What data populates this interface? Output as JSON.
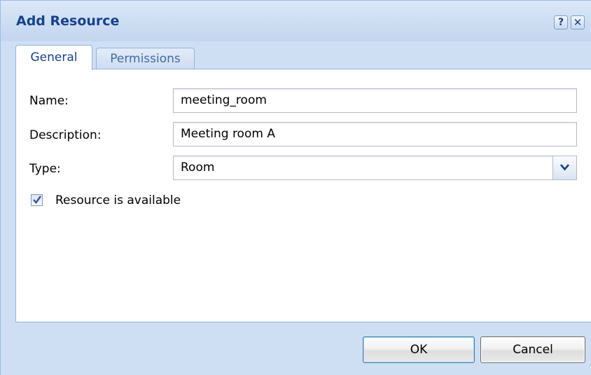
{
  "window": {
    "title": "Add Resource",
    "help_glyph": "?",
    "close_glyph": "✕"
  },
  "tabs": [
    {
      "label": "General",
      "active": true
    },
    {
      "label": "Permissions",
      "active": false
    }
  ],
  "form": {
    "name_label": "Name:",
    "name_value": "meeting_room",
    "description_label": "Description:",
    "description_value": "Meeting room A",
    "type_label": "Type:",
    "type_value": "Room",
    "available_label": "Resource is available",
    "available_checked": true
  },
  "buttons": {
    "ok_label": "OK",
    "cancel_label": "Cancel"
  },
  "icons": {
    "help": "help-icon",
    "close": "close-icon",
    "dropdown": "chevron-down-icon",
    "check": "checkmark-icon"
  },
  "colors": {
    "title_text": "#15428b",
    "window_bg": "#cfdff3",
    "border": "#8db2e3"
  }
}
